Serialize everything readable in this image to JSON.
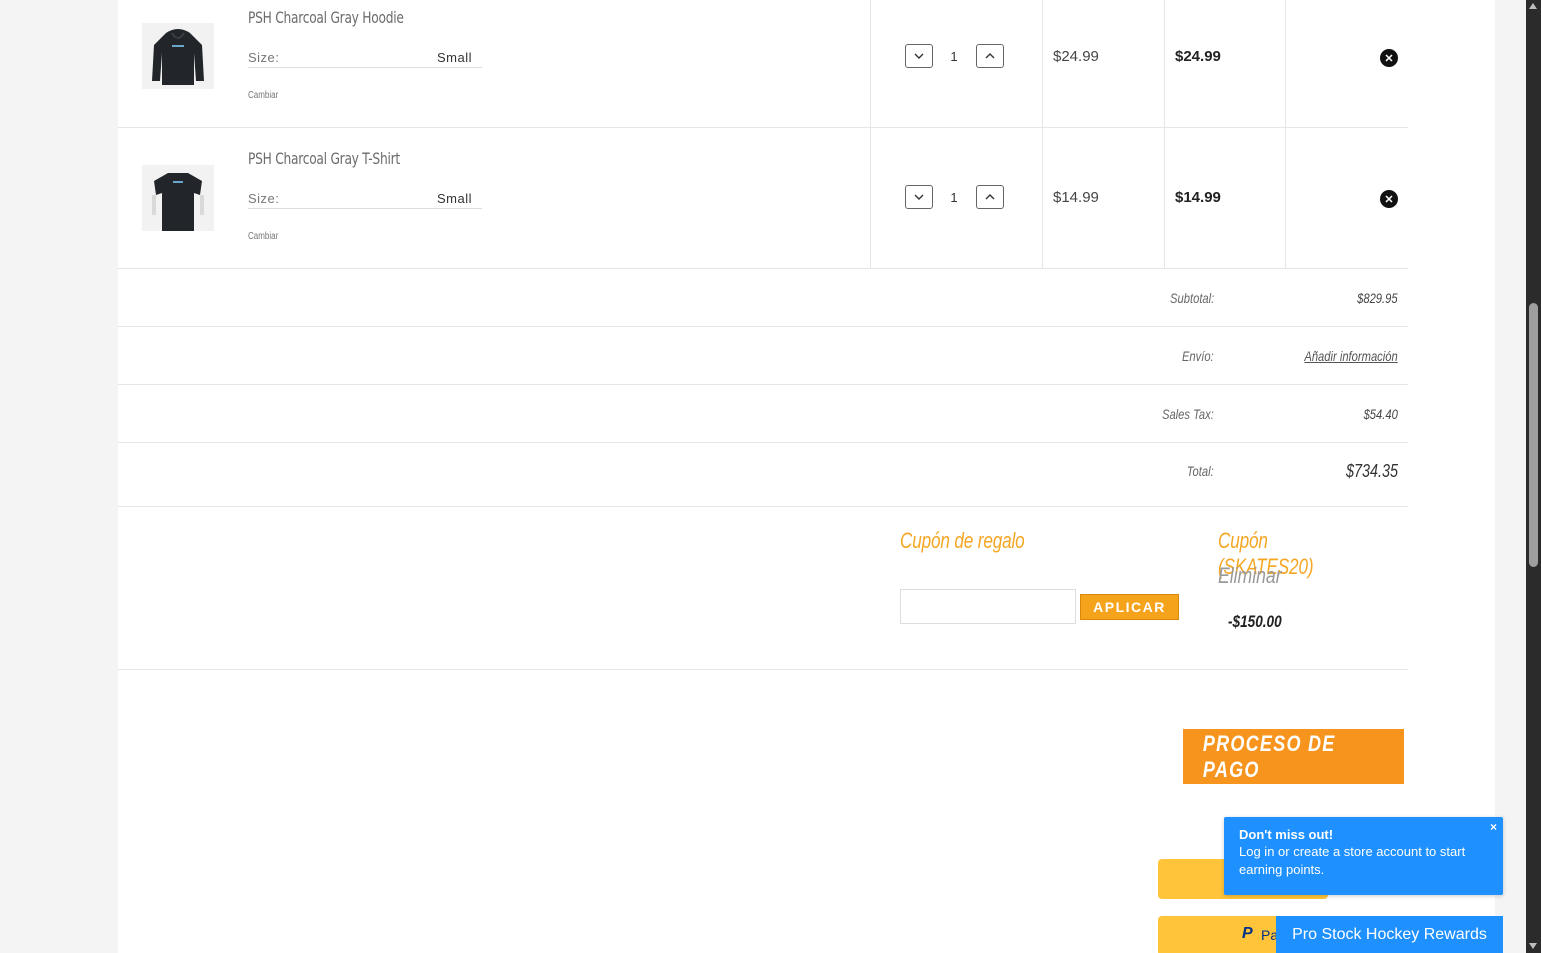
{
  "cart": {
    "items": [
      {
        "name": "PSH Charcoal Gray Hoodie",
        "size_label": "Size:",
        "size_value": "Small",
        "change_label": "Cambiar",
        "quantity": "1",
        "unit_price": "$24.99",
        "line_total": "$24.99",
        "decrease_icon": "chevron-down-icon",
        "increase_icon": "chevron-up-icon",
        "remove_icon": "close-icon"
      },
      {
        "name": "PSH Charcoal Gray T-Shirt",
        "size_label": "Size:",
        "size_value": "Small",
        "change_label": "Cambiar",
        "quantity": "1",
        "unit_price": "$14.99",
        "line_total": "$14.99",
        "decrease_icon": "chevron-down-icon",
        "increase_icon": "chevron-up-icon",
        "remove_icon": "close-icon"
      }
    ]
  },
  "summary": {
    "subtotal_label": "Subtotal:",
    "subtotal_value": "$829.95",
    "shipping_label": "Envío:",
    "shipping_value": "Añadir información",
    "tax_label": "Sales Tax:",
    "tax_value": "$54.40",
    "total_label": "Total:",
    "total_value": "$734.35"
  },
  "coupons": {
    "gift_title": "Cupón de regalo",
    "gift_input_value": "",
    "apply_label": "APLICAR",
    "applied_title": "Cupón (SKATES20)",
    "remove_label": "Eliminar",
    "discount_value": "-$150.00"
  },
  "checkout": {
    "button_label": "PROCESO DE PAGO",
    "paypal_label": "Pa"
  },
  "popup": {
    "title": "Don't miss out!",
    "message": "Log in or create a store account to start earning points.",
    "close_label": "×"
  },
  "rewards": {
    "label": "Pro Stock Hockey Rewards"
  },
  "colors": {
    "accent_orange": "#f7941d",
    "coupon_orange": "#f5a623",
    "paypal_yellow": "#ffc439",
    "popup_blue": "#1e90ff"
  }
}
